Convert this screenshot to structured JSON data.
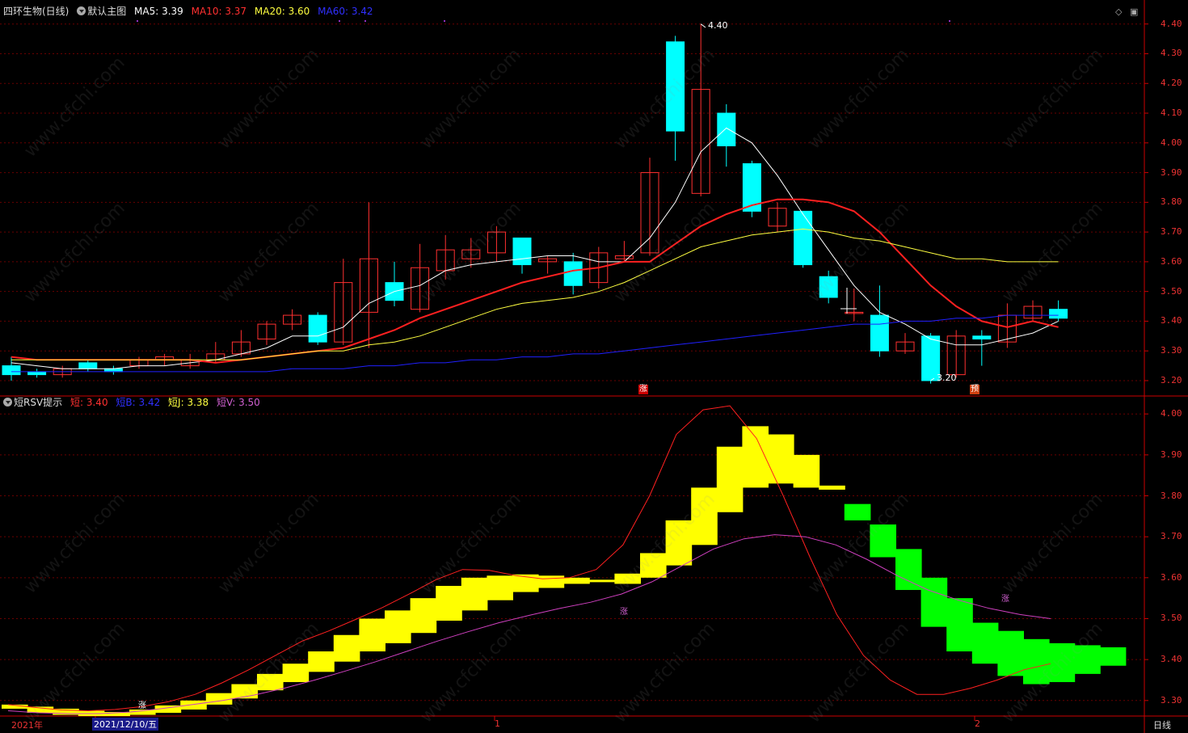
{
  "main_header": {
    "title": "四环生物(日线)",
    "template": "默认主图",
    "ma5": "MA5: 3.39",
    "ma10": "MA10: 3.37",
    "ma20": "MA20: 3.60",
    "ma60": "MA60: 3.42"
  },
  "sub_header": {
    "title": "短RSV提示",
    "a": "短: 3.40",
    "b": "短B: 3.42",
    "j": "短J: 3.38",
    "v": "短V: 3.50"
  },
  "annotations": {
    "high": "4.40",
    "low": "3.20",
    "zhang": "涨",
    "yu": "预"
  },
  "xaxis": {
    "year": "2021年",
    "cursor_date": "2021/12/10/五",
    "m1": "1",
    "m2": "2",
    "period_button": "日线"
  },
  "watermark": "www.cfchi.com",
  "colors": {
    "up": "#ff3030",
    "down": "#00ffff",
    "ma5": "#ffffff",
    "ma10": "#ff2020",
    "ma20": "#ffff40",
    "ma60": "#2020ff",
    "rsv_up": "#ffff00",
    "rsv_down": "#00ff00",
    "axis": "#cc0000"
  },
  "chart_data": [
    {
      "type": "candlestick",
      "title": "四环生物(日线)",
      "ylim": [
        3.17,
        4.44
      ],
      "yticks": [
        3.2,
        3.3,
        3.4,
        3.5,
        3.6,
        3.7,
        3.8,
        3.9,
        4.0,
        4.1,
        4.2,
        4.3,
        4.4
      ],
      "candles": [
        [
          3.25,
          3.22,
          3.28,
          3.2
        ],
        [
          3.23,
          3.22,
          3.24,
          3.21
        ],
        [
          3.22,
          3.24,
          3.25,
          3.21
        ],
        [
          3.26,
          3.24,
          3.27,
          3.23
        ],
        [
          3.24,
          3.23,
          3.25,
          3.22
        ],
        [
          3.25,
          3.27,
          3.28,
          3.24
        ],
        [
          3.27,
          3.28,
          3.29,
          3.25
        ],
        [
          3.25,
          3.27,
          3.29,
          3.24
        ],
        [
          3.27,
          3.29,
          3.33,
          3.26
        ],
        [
          3.29,
          3.33,
          3.37,
          3.28
        ],
        [
          3.34,
          3.39,
          3.4,
          3.32
        ],
        [
          3.39,
          3.42,
          3.44,
          3.37
        ],
        [
          3.42,
          3.33,
          3.43,
          3.32
        ],
        [
          3.33,
          3.53,
          3.61,
          3.32
        ],
        [
          3.43,
          3.61,
          3.8,
          3.31
        ],
        [
          3.53,
          3.47,
          3.6,
          3.45
        ],
        [
          3.44,
          3.58,
          3.66,
          3.43
        ],
        [
          3.57,
          3.64,
          3.69,
          3.54
        ],
        [
          3.61,
          3.64,
          3.68,
          3.58
        ],
        [
          3.63,
          3.7,
          3.72,
          3.6
        ],
        [
          3.68,
          3.59,
          3.68,
          3.56
        ],
        [
          3.6,
          3.61,
          3.62,
          3.56
        ],
        [
          3.6,
          3.52,
          3.63,
          3.49
        ],
        [
          3.53,
          3.63,
          3.65,
          3.51
        ],
        [
          3.61,
          3.62,
          3.67,
          3.6
        ],
        [
          3.63,
          3.9,
          3.95,
          3.62
        ],
        [
          4.34,
          4.04,
          4.36,
          3.94
        ],
        [
          3.83,
          4.18,
          4.4,
          3.82
        ],
        [
          4.1,
          3.99,
          4.13,
          3.92
        ],
        [
          3.93,
          3.77,
          3.94,
          3.75
        ],
        [
          3.72,
          3.78,
          3.8,
          3.7
        ],
        [
          3.77,
          3.59,
          3.77,
          3.58
        ],
        [
          3.55,
          3.48,
          3.57,
          3.46
        ],
        [
          3.43,
          3.43,
          3.51,
          3.4
        ],
        [
          3.42,
          3.3,
          3.52,
          3.28
        ],
        [
          3.3,
          3.33,
          3.36,
          3.29
        ],
        [
          3.35,
          3.2,
          3.36,
          3.19
        ],
        [
          3.22,
          3.35,
          3.37,
          3.21
        ],
        [
          3.35,
          3.34,
          3.37,
          3.25
        ],
        [
          3.33,
          3.42,
          3.46,
          3.31
        ],
        [
          3.41,
          3.45,
          3.47,
          3.4
        ],
        [
          3.44,
          3.41,
          3.47,
          3.4
        ]
      ],
      "series": [
        {
          "name": "MA5",
          "values": [
            3.26,
            3.25,
            3.24,
            3.24,
            3.24,
            3.25,
            3.25,
            3.26,
            3.27,
            3.29,
            3.31,
            3.35,
            3.35,
            3.38,
            3.46,
            3.5,
            3.52,
            3.57,
            3.59,
            3.6,
            3.61,
            3.62,
            3.62,
            3.6,
            3.6,
            3.68,
            3.8,
            3.97,
            4.05,
            4.0,
            3.89,
            3.76,
            3.64,
            3.52,
            3.43,
            3.39,
            3.34,
            3.32,
            3.32,
            3.34,
            3.36,
            3.4
          ]
        },
        {
          "name": "MA10",
          "values": [
            3.28,
            3.27,
            3.27,
            3.27,
            3.27,
            3.27,
            3.27,
            3.27,
            3.26,
            3.27,
            3.28,
            3.29,
            3.3,
            3.31,
            3.34,
            3.37,
            3.41,
            3.44,
            3.47,
            3.5,
            3.53,
            3.55,
            3.57,
            3.58,
            3.6,
            3.6,
            3.66,
            3.72,
            3.76,
            3.79,
            3.81,
            3.81,
            3.8,
            3.77,
            3.7,
            3.61,
            3.52,
            3.45,
            3.4,
            3.38,
            3.4,
            3.38
          ]
        },
        {
          "name": "MA20",
          "values": [
            3.27,
            3.27,
            3.27,
            3.27,
            3.27,
            3.27,
            3.27,
            3.27,
            3.27,
            3.27,
            3.28,
            3.29,
            3.3,
            3.3,
            3.32,
            3.33,
            3.35,
            3.38,
            3.41,
            3.44,
            3.46,
            3.47,
            3.48,
            3.5,
            3.53,
            3.57,
            3.61,
            3.65,
            3.67,
            3.69,
            3.7,
            3.71,
            3.7,
            3.68,
            3.67,
            3.65,
            3.63,
            3.61,
            3.61,
            3.6,
            3.6,
            3.6
          ]
        },
        {
          "name": "MA60",
          "values": [
            3.23,
            3.23,
            3.23,
            3.23,
            3.23,
            3.23,
            3.23,
            3.23,
            3.23,
            3.23,
            3.23,
            3.24,
            3.24,
            3.24,
            3.25,
            3.25,
            3.26,
            3.26,
            3.27,
            3.27,
            3.28,
            3.28,
            3.29,
            3.29,
            3.3,
            3.31,
            3.32,
            3.33,
            3.34,
            3.35,
            3.36,
            3.37,
            3.38,
            3.39,
            3.39,
            3.4,
            3.4,
            3.41,
            3.41,
            3.42,
            3.42,
            3.42
          ]
        }
      ]
    },
    {
      "type": "band",
      "title": "短RSV提示",
      "ylim": [
        3.27,
        4.03
      ],
      "yticks": [
        3.3,
        3.4,
        3.5,
        3.6,
        3.7,
        3.8,
        3.9,
        4.0
      ],
      "bands": [
        [
          3.29,
          3.28
        ],
        [
          3.285,
          3.27
        ],
        [
          3.28,
          3.265
        ],
        [
          3.275,
          3.262
        ],
        [
          3.272,
          3.262
        ],
        [
          3.278,
          3.265
        ],
        [
          3.288,
          3.27
        ],
        [
          3.3,
          3.278
        ],
        [
          3.318,
          3.29
        ],
        [
          3.34,
          3.305
        ],
        [
          3.365,
          3.325
        ],
        [
          3.39,
          3.345
        ],
        [
          3.42,
          3.37
        ],
        [
          3.46,
          3.395
        ],
        [
          3.5,
          3.42
        ],
        [
          3.52,
          3.44
        ],
        [
          3.55,
          3.465
        ],
        [
          3.58,
          3.495
        ],
        [
          3.6,
          3.52
        ],
        [
          3.605,
          3.545
        ],
        [
          3.608,
          3.565
        ],
        [
          3.605,
          3.575
        ],
        [
          3.6,
          3.585
        ],
        [
          3.595,
          3.59
        ],
        [
          3.61,
          3.585
        ],
        [
          3.66,
          3.6
        ],
        [
          3.74,
          3.63
        ],
        [
          3.82,
          3.68
        ],
        [
          3.92,
          3.76
        ],
        [
          3.97,
          3.82
        ],
        [
          3.95,
          3.83
        ],
        [
          3.9,
          3.82
        ],
        [
          3.825,
          3.815
        ],
        [
          3.78,
          3.74
        ],
        [
          3.73,
          3.65
        ],
        [
          3.67,
          3.57
        ],
        [
          3.6,
          3.48
        ],
        [
          3.55,
          3.42
        ],
        [
          3.49,
          3.39
        ],
        [
          3.47,
          3.36
        ],
        [
          3.45,
          3.34
        ],
        [
          3.44,
          3.345
        ],
        [
          3.435,
          3.365
        ],
        [
          3.43,
          3.385
        ]
      ],
      "series": [
        {
          "name": "短",
          "values": [
            3.29,
            3.283,
            3.277,
            3.275,
            3.278,
            3.285,
            3.297,
            3.315,
            3.343,
            3.375,
            3.41,
            3.445,
            3.47,
            3.498,
            3.527,
            3.56,
            3.595,
            3.62,
            3.618,
            3.605,
            3.597,
            3.6,
            3.62,
            3.68,
            3.8,
            3.95,
            4.01,
            4.02,
            3.94,
            3.8,
            3.65,
            3.51,
            3.41,
            3.35,
            3.315,
            3.315,
            3.33,
            3.35,
            3.375,
            3.39
          ]
        },
        {
          "name": "短V",
          "values": [
            3.275,
            3.27,
            3.268,
            3.268,
            3.272,
            3.28,
            3.29,
            3.3,
            3.313,
            3.33,
            3.35,
            3.372,
            3.395,
            3.42,
            3.445,
            3.468,
            3.49,
            3.508,
            3.525,
            3.54,
            3.56,
            3.59,
            3.63,
            3.67,
            3.695,
            3.705,
            3.7,
            3.68,
            3.645,
            3.605,
            3.57,
            3.545,
            3.525,
            3.51,
            3.5
          ]
        }
      ]
    }
  ]
}
